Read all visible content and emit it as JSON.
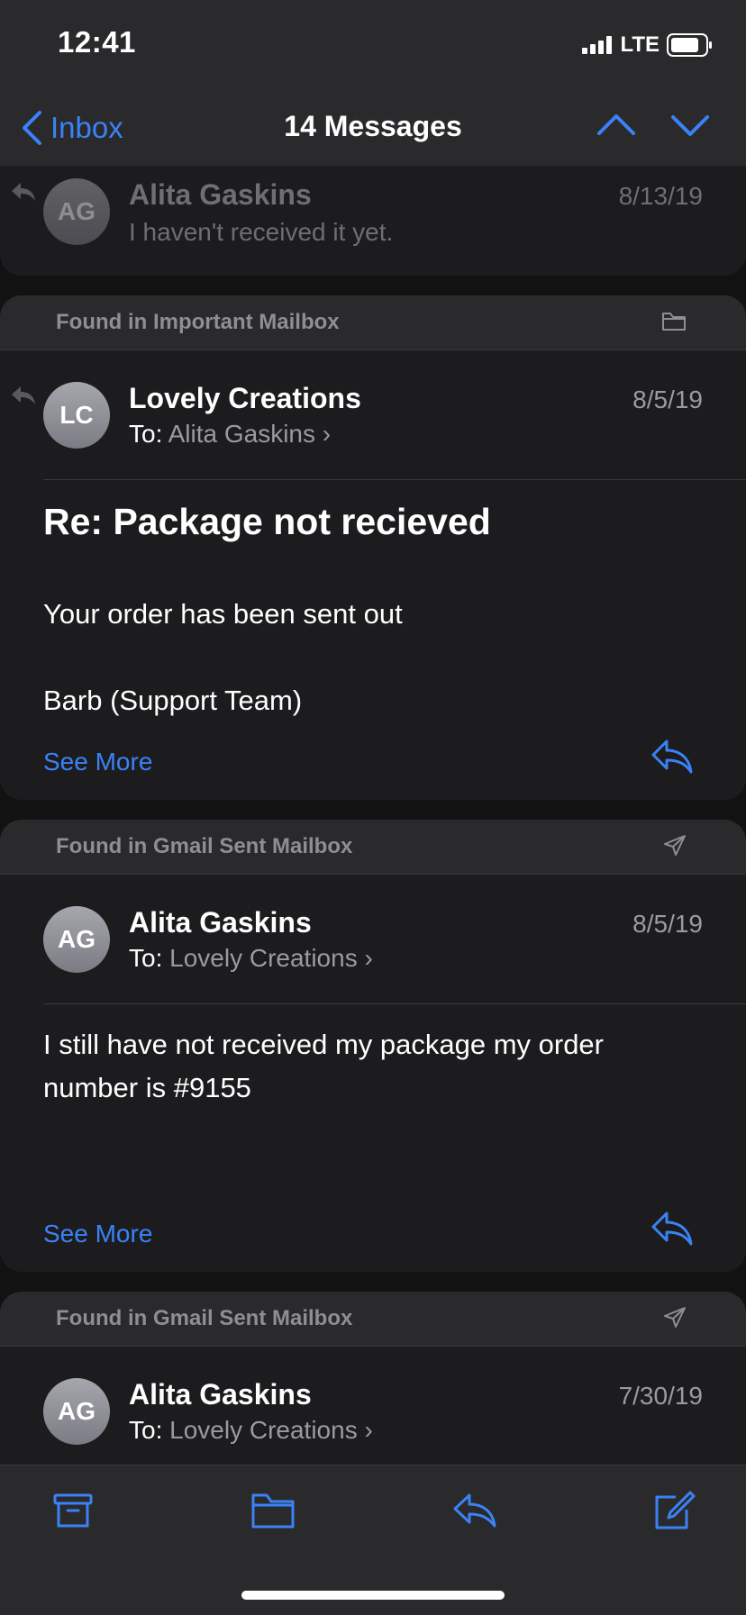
{
  "status": {
    "time": "12:41",
    "network": "LTE"
  },
  "nav": {
    "back_label": "Inbox",
    "title": "14 Messages"
  },
  "collapsed_message": {
    "avatar": "AG",
    "sender": "Alita Gaskins",
    "date": "8/13/19",
    "preview": "I haven't received it yet."
  },
  "messages": [
    {
      "header": "Found in Important Mailbox",
      "header_icon": "folder-icon",
      "avatar": "LC",
      "sender": "Lovely Creations",
      "to_label": "To:",
      "to": "Alita Gaskins",
      "date": "8/5/19",
      "subject": "Re: Package not recieved",
      "body": [
        "Your order has been sent out",
        "Barb (Support Team)"
      ],
      "see_more": "See More"
    },
    {
      "header": "Found in Gmail Sent Mailbox",
      "header_icon": "sent-icon",
      "avatar": "AG",
      "sender": "Alita Gaskins",
      "to_label": "To:",
      "to": "Lovely Creations",
      "date": "8/5/19",
      "body": [
        "I still have not received my package my order number is #9155"
      ],
      "see_more": "See More"
    },
    {
      "header": "Found in Gmail Sent Mailbox",
      "header_icon": "sent-icon",
      "avatar": "AG",
      "sender": "Alita Gaskins",
      "to_label": "To:",
      "to": "Lovely Creations",
      "date": "7/30/19"
    }
  ],
  "toolbar": [
    "archive-icon",
    "folder-icon",
    "reply-icon",
    "compose-icon"
  ],
  "colors": {
    "accent": "#3b82f6",
    "background": "#121212",
    "card": "#1c1c1e",
    "header": "#2a2a2c"
  }
}
